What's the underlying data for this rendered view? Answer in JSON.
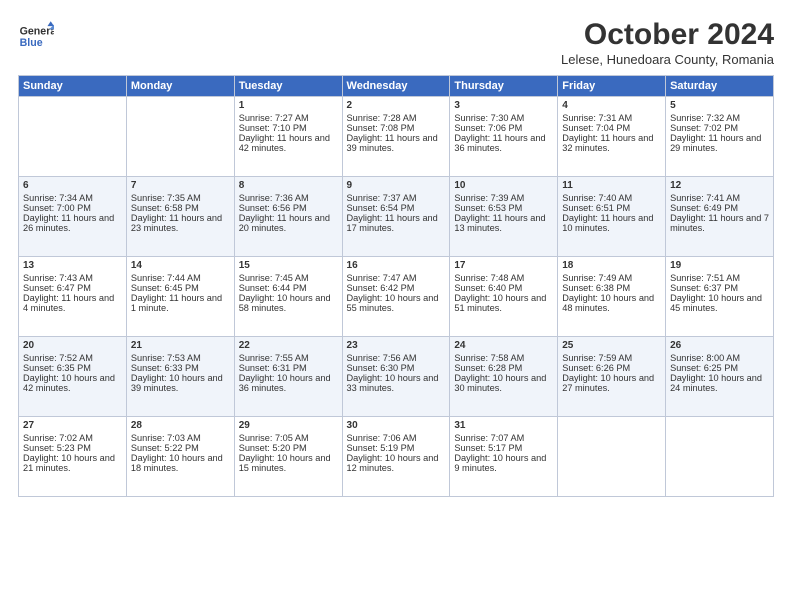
{
  "header": {
    "logo_text_line1": "General",
    "logo_text_line2": "Blue",
    "month": "October 2024",
    "location": "Lelese, Hunedoara County, Romania"
  },
  "weekdays": [
    "Sunday",
    "Monday",
    "Tuesday",
    "Wednesday",
    "Thursday",
    "Friday",
    "Saturday"
  ],
  "weeks": [
    [
      {
        "day": "",
        "info": ""
      },
      {
        "day": "",
        "info": ""
      },
      {
        "day": "1",
        "info": "Sunrise: 7:27 AM\nSunset: 7:10 PM\nDaylight: 11 hours and 42 minutes."
      },
      {
        "day": "2",
        "info": "Sunrise: 7:28 AM\nSunset: 7:08 PM\nDaylight: 11 hours and 39 minutes."
      },
      {
        "day": "3",
        "info": "Sunrise: 7:30 AM\nSunset: 7:06 PM\nDaylight: 11 hours and 36 minutes."
      },
      {
        "day": "4",
        "info": "Sunrise: 7:31 AM\nSunset: 7:04 PM\nDaylight: 11 hours and 32 minutes."
      },
      {
        "day": "5",
        "info": "Sunrise: 7:32 AM\nSunset: 7:02 PM\nDaylight: 11 hours and 29 minutes."
      }
    ],
    [
      {
        "day": "6",
        "info": "Sunrise: 7:34 AM\nSunset: 7:00 PM\nDaylight: 11 hours and 26 minutes."
      },
      {
        "day": "7",
        "info": "Sunrise: 7:35 AM\nSunset: 6:58 PM\nDaylight: 11 hours and 23 minutes."
      },
      {
        "day": "8",
        "info": "Sunrise: 7:36 AM\nSunset: 6:56 PM\nDaylight: 11 hours and 20 minutes."
      },
      {
        "day": "9",
        "info": "Sunrise: 7:37 AM\nSunset: 6:54 PM\nDaylight: 11 hours and 17 minutes."
      },
      {
        "day": "10",
        "info": "Sunrise: 7:39 AM\nSunset: 6:53 PM\nDaylight: 11 hours and 13 minutes."
      },
      {
        "day": "11",
        "info": "Sunrise: 7:40 AM\nSunset: 6:51 PM\nDaylight: 11 hours and 10 minutes."
      },
      {
        "day": "12",
        "info": "Sunrise: 7:41 AM\nSunset: 6:49 PM\nDaylight: 11 hours and 7 minutes."
      }
    ],
    [
      {
        "day": "13",
        "info": "Sunrise: 7:43 AM\nSunset: 6:47 PM\nDaylight: 11 hours and 4 minutes."
      },
      {
        "day": "14",
        "info": "Sunrise: 7:44 AM\nSunset: 6:45 PM\nDaylight: 11 hours and 1 minute."
      },
      {
        "day": "15",
        "info": "Sunrise: 7:45 AM\nSunset: 6:44 PM\nDaylight: 10 hours and 58 minutes."
      },
      {
        "day": "16",
        "info": "Sunrise: 7:47 AM\nSunset: 6:42 PM\nDaylight: 10 hours and 55 minutes."
      },
      {
        "day": "17",
        "info": "Sunrise: 7:48 AM\nSunset: 6:40 PM\nDaylight: 10 hours and 51 minutes."
      },
      {
        "day": "18",
        "info": "Sunrise: 7:49 AM\nSunset: 6:38 PM\nDaylight: 10 hours and 48 minutes."
      },
      {
        "day": "19",
        "info": "Sunrise: 7:51 AM\nSunset: 6:37 PM\nDaylight: 10 hours and 45 minutes."
      }
    ],
    [
      {
        "day": "20",
        "info": "Sunrise: 7:52 AM\nSunset: 6:35 PM\nDaylight: 10 hours and 42 minutes."
      },
      {
        "day": "21",
        "info": "Sunrise: 7:53 AM\nSunset: 6:33 PM\nDaylight: 10 hours and 39 minutes."
      },
      {
        "day": "22",
        "info": "Sunrise: 7:55 AM\nSunset: 6:31 PM\nDaylight: 10 hours and 36 minutes."
      },
      {
        "day": "23",
        "info": "Sunrise: 7:56 AM\nSunset: 6:30 PM\nDaylight: 10 hours and 33 minutes."
      },
      {
        "day": "24",
        "info": "Sunrise: 7:58 AM\nSunset: 6:28 PM\nDaylight: 10 hours and 30 minutes."
      },
      {
        "day": "25",
        "info": "Sunrise: 7:59 AM\nSunset: 6:26 PM\nDaylight: 10 hours and 27 minutes."
      },
      {
        "day": "26",
        "info": "Sunrise: 8:00 AM\nSunset: 6:25 PM\nDaylight: 10 hours and 24 minutes."
      }
    ],
    [
      {
        "day": "27",
        "info": "Sunrise: 7:02 AM\nSunset: 5:23 PM\nDaylight: 10 hours and 21 minutes."
      },
      {
        "day": "28",
        "info": "Sunrise: 7:03 AM\nSunset: 5:22 PM\nDaylight: 10 hours and 18 minutes."
      },
      {
        "day": "29",
        "info": "Sunrise: 7:05 AM\nSunset: 5:20 PM\nDaylight: 10 hours and 15 minutes."
      },
      {
        "day": "30",
        "info": "Sunrise: 7:06 AM\nSunset: 5:19 PM\nDaylight: 10 hours and 12 minutes."
      },
      {
        "day": "31",
        "info": "Sunrise: 7:07 AM\nSunset: 5:17 PM\nDaylight: 10 hours and 9 minutes."
      },
      {
        "day": "",
        "info": ""
      },
      {
        "day": "",
        "info": ""
      }
    ]
  ]
}
